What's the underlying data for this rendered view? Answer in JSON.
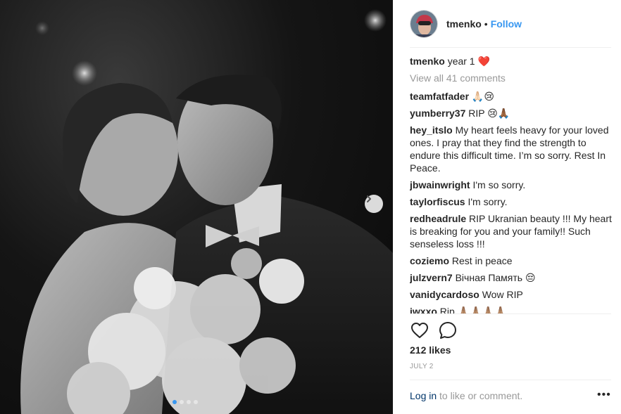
{
  "header": {
    "username": "tmenko",
    "separator": "•",
    "follow_label": "Follow"
  },
  "caption": {
    "username": "tmenko",
    "text": "year 1 ❤️"
  },
  "view_all_label": "View all 41 comments",
  "comments": [
    {
      "user": "teamfatfader",
      "text": "🙏🏻😢"
    },
    {
      "user": "yumberry37",
      "text": "RIP 😢🙏🏾"
    },
    {
      "user": "hey_itslo",
      "text": "My heart feels heavy for your loved ones. I pray that they find the strength to endure this difficult time. I’m so sorry. Rest In Peace."
    },
    {
      "user": "jbwainwright",
      "text": "I'm so sorry."
    },
    {
      "user": "taylorfiscus",
      "text": "I'm sorry."
    },
    {
      "user": "redheadrule",
      "text": "RIP Ukranian beauty !!! My heart is breaking for you and your family!! Such senseless loss !!!"
    },
    {
      "user": "coziemo",
      "text": "Rest in peace"
    },
    {
      "user": "julzvern7",
      "text": "Вічная Память 😔"
    },
    {
      "user": "vanidycardoso",
      "text": "Wow RIP"
    },
    {
      "user": "iwxxo",
      "text": "Rip 🙏🏽🙏🏽🙏🏽🙏🏽"
    }
  ],
  "actions": {
    "like_icon": "heart-outline-icon",
    "comment_icon": "comment-bubble-icon"
  },
  "likes_label": "212 likes",
  "date_label": "JULY 2",
  "login": {
    "link_label": "Log in",
    "rest_label": "to like or comment."
  },
  "more_label": "•••",
  "carousel": {
    "current": 1,
    "total": 4
  },
  "colors": {
    "accent": "#3897f0",
    "muted": "#999999",
    "border": "#efefef"
  }
}
